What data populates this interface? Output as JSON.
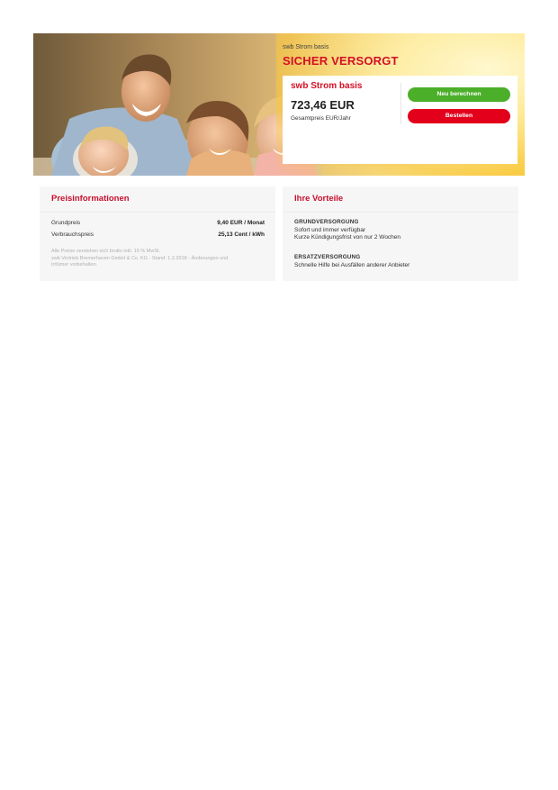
{
  "hero": {
    "kicker": "swb Strom basis",
    "title": "SICHER VERSORGT",
    "image_description_icon": "family-photo"
  },
  "price_card": {
    "product_name": "swb Strom basis",
    "total_price": "723,46 EUR",
    "total_label": "Gesamtpreis EUR/Jahr",
    "recalc_button": "Neu berechnen",
    "order_button": "Bestellen"
  },
  "price_info": {
    "title": "Preisinformationen",
    "rows": [
      {
        "label": "Grundpreis",
        "value": "9,40 EUR / Monat"
      },
      {
        "label": "Verbrauchspreis",
        "value": "25,13 Cent / kWh"
      }
    ],
    "footnote_lines": [
      "Alle Preise verstehen sich brutto inkl. 19 % MwSt.",
      "swb Vertrieb Bremerhaven GmbH & Co. KG - Stand: 1.2.2018 - Änderungen und",
      "Irrtümer vorbehalten."
    ]
  },
  "benefits": {
    "title": "Ihre Vorteile",
    "items": [
      {
        "heading": "GRUNDVERSORGUNG",
        "lines": [
          "Sofort und immer verfügbar",
          "Kurze Kündigungsfrist von nur 2 Wochen"
        ]
      },
      {
        "heading": "ERSATZVERSORGUNG",
        "lines": [
          "Schnelle Hilfe bei Ausfällen anderer Anbieter"
        ]
      }
    ]
  },
  "colors": {
    "brand_red": "#d50f25",
    "button_green": "#4caf2a",
    "button_red": "#e2001a",
    "panel_bg": "#f6f6f6"
  }
}
